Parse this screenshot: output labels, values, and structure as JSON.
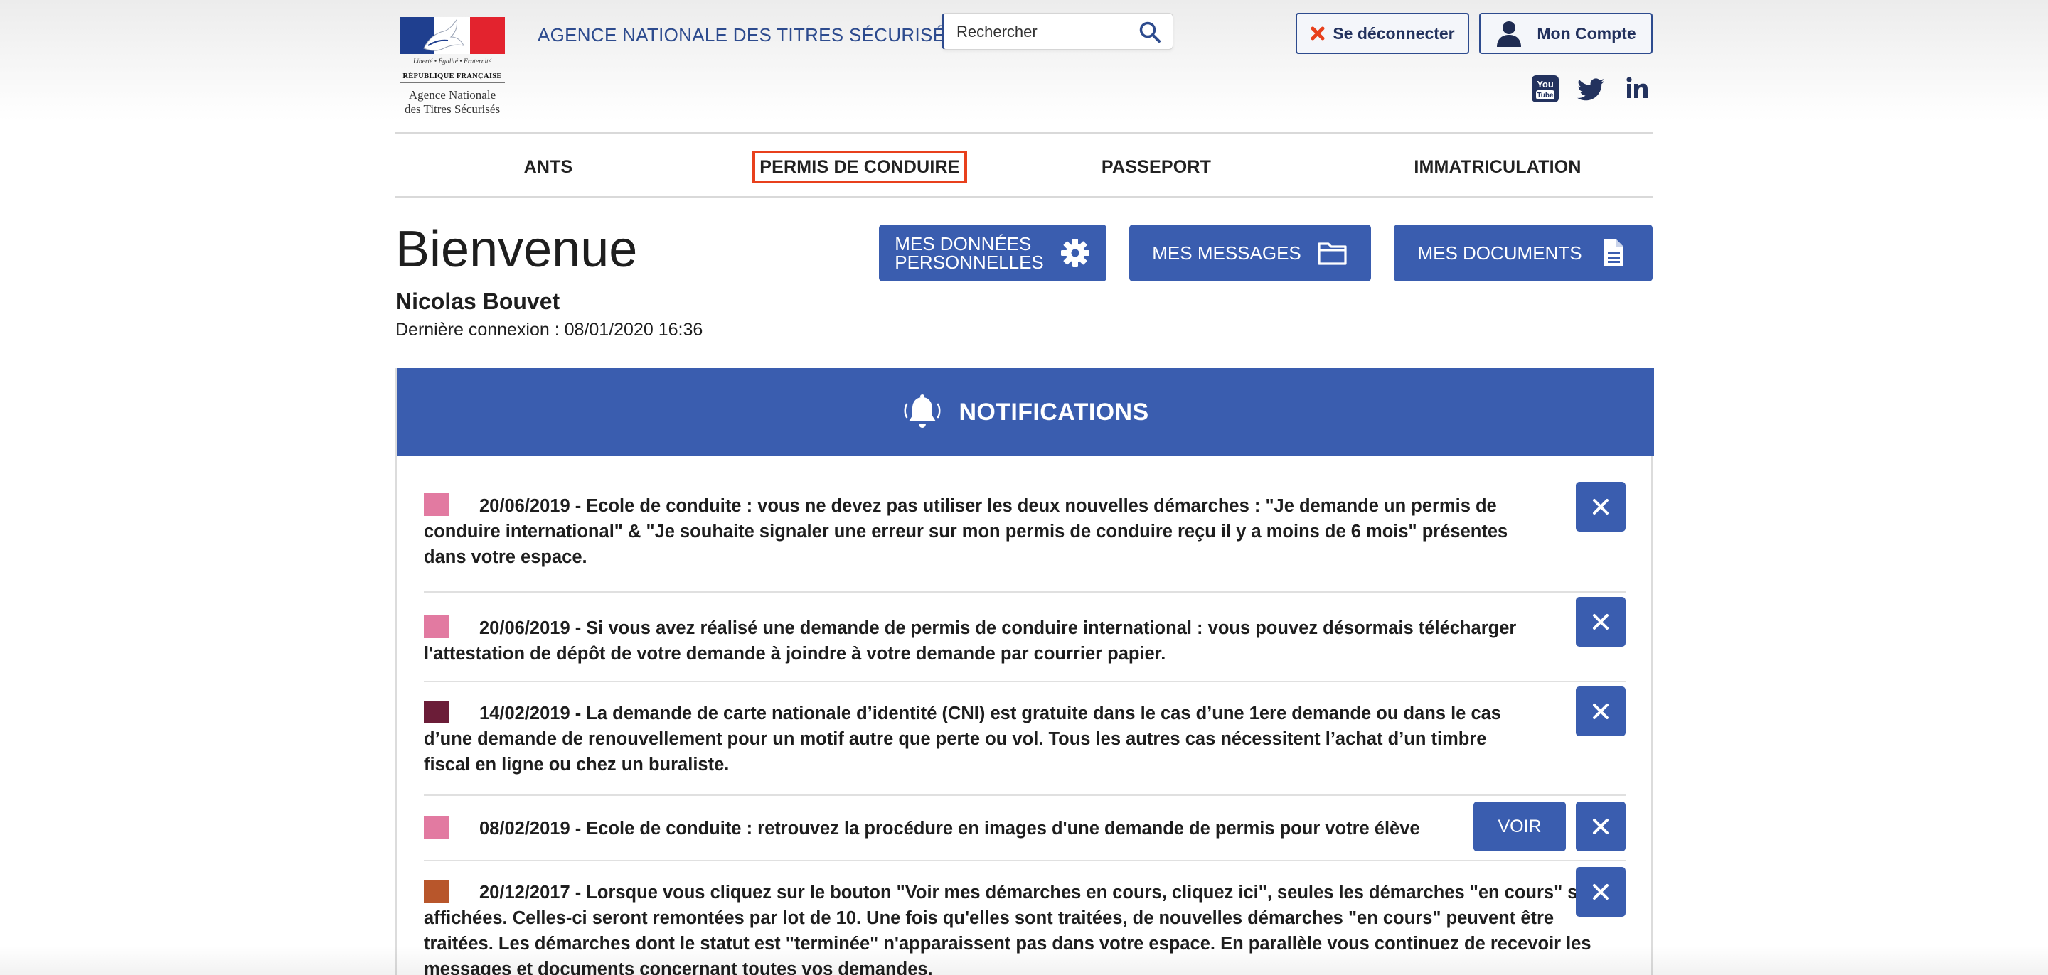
{
  "header": {
    "logo": {
      "motto": "Liberté • Égalité • Fraternité",
      "republique": "RÉPUBLIQUE FRANÇAISE",
      "agency_line1": "Agence Nationale",
      "agency_line2": "des Titres Sécurisés"
    },
    "agency_title": "AGENCE NATIONALE DES TITRES SÉCURISÉS",
    "search": {
      "placeholder": "Rechercher"
    },
    "logout_label": "Se déconnecter",
    "account_label": "Mon Compte",
    "social": [
      "youtube-icon",
      "twitter-icon",
      "linkedin-icon"
    ]
  },
  "nav": {
    "items": [
      "ANTS",
      "PERMIS DE CONDUIRE",
      "PASSEPORT",
      "IMMATRICULATION"
    ],
    "highlighted": "PERMIS DE CONDUIRE"
  },
  "welcome": {
    "title": "Bienvenue",
    "user_name": "Nicolas Bouvet",
    "last_login": "Dernière connexion : 08/01/2020 16:36"
  },
  "actions": {
    "donnees_line1": "MES DONNÉES",
    "donnees_line2": "PERSONNELLES",
    "messages": "MES MESSAGES",
    "documents": "MES DOCUMENTS"
  },
  "notifications": {
    "title": "NOTIFICATIONS",
    "voir_label": "VOIR",
    "items": [
      {
        "color": "#e27aa1",
        "text": "20/06/2019 - Ecole de conduite : vous ne devez pas utiliser les deux nouvelles démarches : \"Je demande un permis de conduire international\" & \"Je souhaite signaler une erreur sur mon permis de conduire reçu il y a moins de 6 mois\" présentes dans votre espace."
      },
      {
        "color": "#e27aa1",
        "text": "20/06/2019 - Si vous avez réalisé une demande de permis de conduire international : vous pouvez désormais télécharger l'attestation de dépôt de votre demande à joindre à votre demande par courrier papier."
      },
      {
        "color": "#6b1d38",
        "text": "14/02/2019 - La demande de carte nationale d’identité (CNI) est gratuite dans le cas d’une 1ere demande ou dans le cas d’une demande de renouvellement pour un motif autre que perte ou vol. Tous les autres cas nécessitent l’achat d’un timbre fiscal en ligne ou chez un buraliste."
      },
      {
        "color": "#e27aa1",
        "text": "08/02/2019 - Ecole de conduite : retrouvez la procédure en images d'une demande de permis pour votre élève",
        "has_voir": true
      },
      {
        "color": "#b8562b",
        "text": "20/12/2017 - Lorsque vous cliquez sur le bouton \"Voir mes démarches en cours, cliquez ici\", seules les démarches \"en cours\" sont affichées. Celles-ci seront remontées par lot de 10. Une fois qu'elles sont traitées, de nouvelles démarches \"en cours\" peuvent être traitées. Les démarches dont le statut est \"terminée\" n'apparaissent pas dans votre espace. En parallèle vous continuez de recevoir les messages et documents concernant toutes vos demandes."
      }
    ]
  },
  "colors": {
    "primary": "#3a5daf",
    "title_blue": "#2d4b8e",
    "highlight_border": "#e8401c"
  }
}
